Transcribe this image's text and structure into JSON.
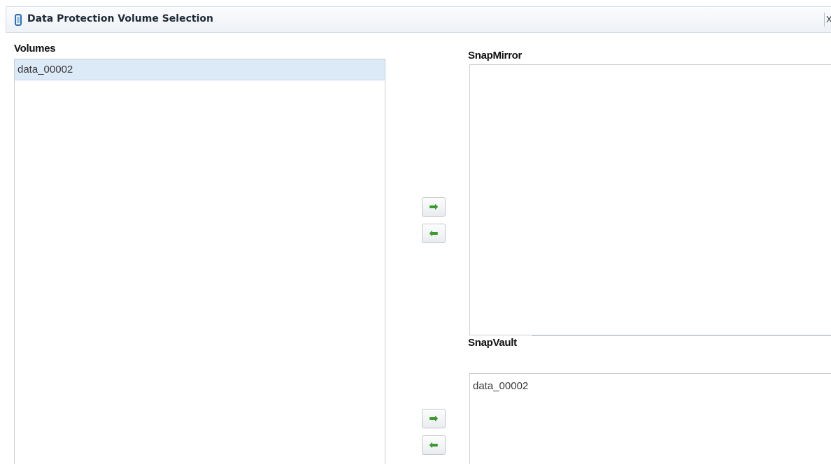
{
  "window": {
    "title": "Data Protection Volume Selection",
    "close_label": "X"
  },
  "volumes": {
    "label": "Volumes",
    "items": [
      "data_00002"
    ],
    "selected_index": 0
  },
  "snapmirror": {
    "label": "SnapMirror",
    "items": [],
    "add_glyph": "➡",
    "remove_glyph": "⬅"
  },
  "snapvault": {
    "label": "SnapVault",
    "items": [
      "data_00002"
    ],
    "add_glyph": "➡",
    "remove_glyph": "⬅"
  },
  "colors": {
    "selection": "#dce9f7",
    "arrow": "#3b9a2e",
    "title_icon": "#2f6fb6"
  }
}
